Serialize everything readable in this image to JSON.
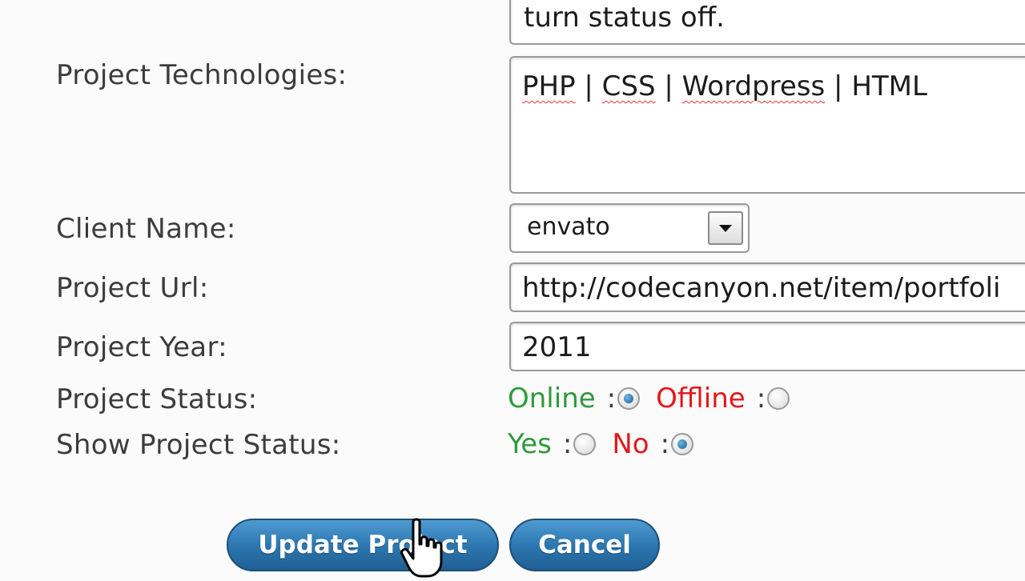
{
  "form": {
    "status_note": "turn status off.",
    "technologies": {
      "label": "Project Technologies:",
      "items": [
        "PHP",
        "CSS",
        "Wordpress",
        "HTML"
      ],
      "separator": "|"
    },
    "client": {
      "label": "Client Name:",
      "selected": "envato"
    },
    "url": {
      "label": "Project Url:",
      "value": "http://codecanyon.net/item/portfoli"
    },
    "year": {
      "label": "Project Year:",
      "value": "2011"
    },
    "status": {
      "label": "Project Status:",
      "online_label": "Online",
      "offline_label": "Offline",
      "selected": "Online"
    },
    "show_status": {
      "label": "Show Project Status:",
      "yes_label": "Yes",
      "no_label": "No",
      "selected": "No"
    },
    "colon": ":",
    "buttons": {
      "update": "Update Project",
      "cancel": "Cancel"
    }
  },
  "colors": {
    "online": "#2f9a3a",
    "offline": "#e0191c",
    "button": "#2d78b2"
  },
  "icons": [
    "chevron-down-icon",
    "hand-pointer-icon"
  ]
}
